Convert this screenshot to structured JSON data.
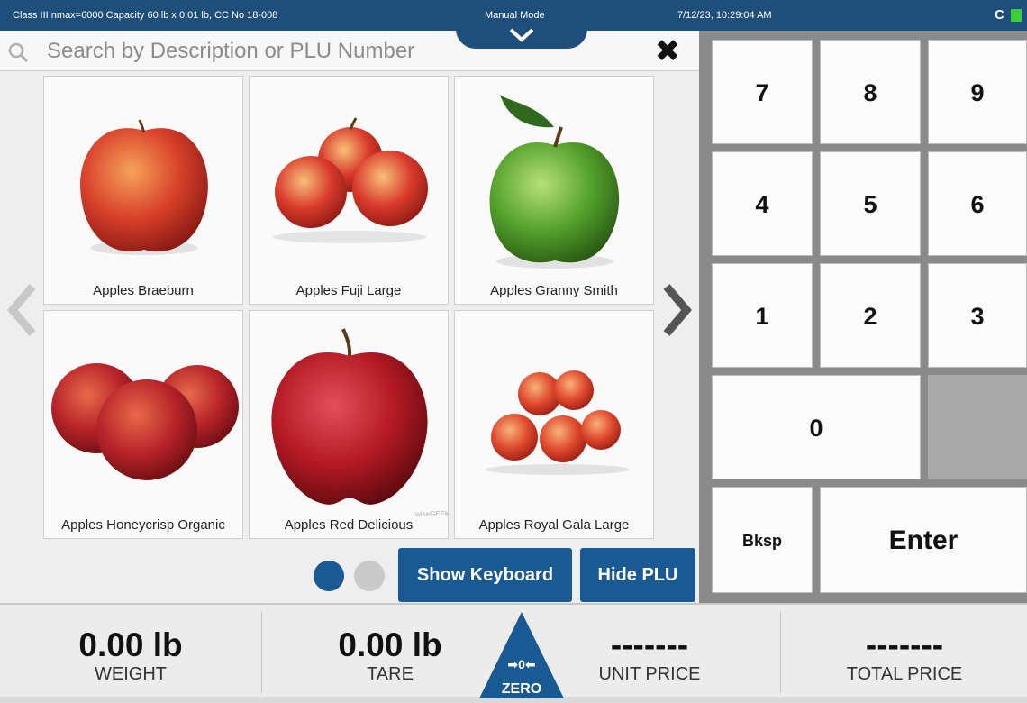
{
  "status_bar": {
    "certification": "Class III nmax=6000 Capacity 60 lb x 0.01 lb, CC No 18-008",
    "mode": "Manual Mode",
    "datetime": "7/12/23, 10:29:04 AM",
    "sync_glyph": "C",
    "battery_color": "#3ccf3c",
    "bar_color": "#1d4f7a"
  },
  "search": {
    "placeholder": "Search by Description or PLU Number",
    "value": "",
    "icon": "search-icon",
    "clear_glyph": "✖"
  },
  "products": [
    {
      "name": "Apples Braeburn",
      "color": "#d8402a"
    },
    {
      "name": "Apples Fuji Large",
      "color": "#d93a2c"
    },
    {
      "name": "Apples Granny Smith",
      "color": "#55a22c"
    },
    {
      "name": "Apples Honeycrisp Organic",
      "color": "#b8242a"
    },
    {
      "name": "Apples Red Delicious",
      "color": "#b51a24"
    },
    {
      "name": "Apples Royal Gala Large",
      "color": "#e04a2e"
    }
  ],
  "watermark": "wiseGEEK",
  "pagination": {
    "pages": 2,
    "current": 1
  },
  "buttons": {
    "show_keyboard": "Show Keyboard",
    "hide_plu": "Hide PLU"
  },
  "keypad": {
    "keys": [
      "7",
      "8",
      "9",
      "4",
      "5",
      "6",
      "1",
      "2",
      "3",
      "0"
    ],
    "backspace": "Bksp",
    "enter": "Enter"
  },
  "readouts": {
    "weight": {
      "value": "0.00 lb",
      "label": "WEIGHT"
    },
    "tare": {
      "value": "0.00 lb",
      "label": "TARE"
    },
    "unit_price": {
      "value": "-------",
      "label": "UNIT PRICE"
    },
    "total_price": {
      "value": "-------",
      "label": "TOTAL PRICE"
    }
  },
  "zero": {
    "symbol": "➡0⬅",
    "label": "ZERO"
  },
  "accent_color": "#1a5a94"
}
